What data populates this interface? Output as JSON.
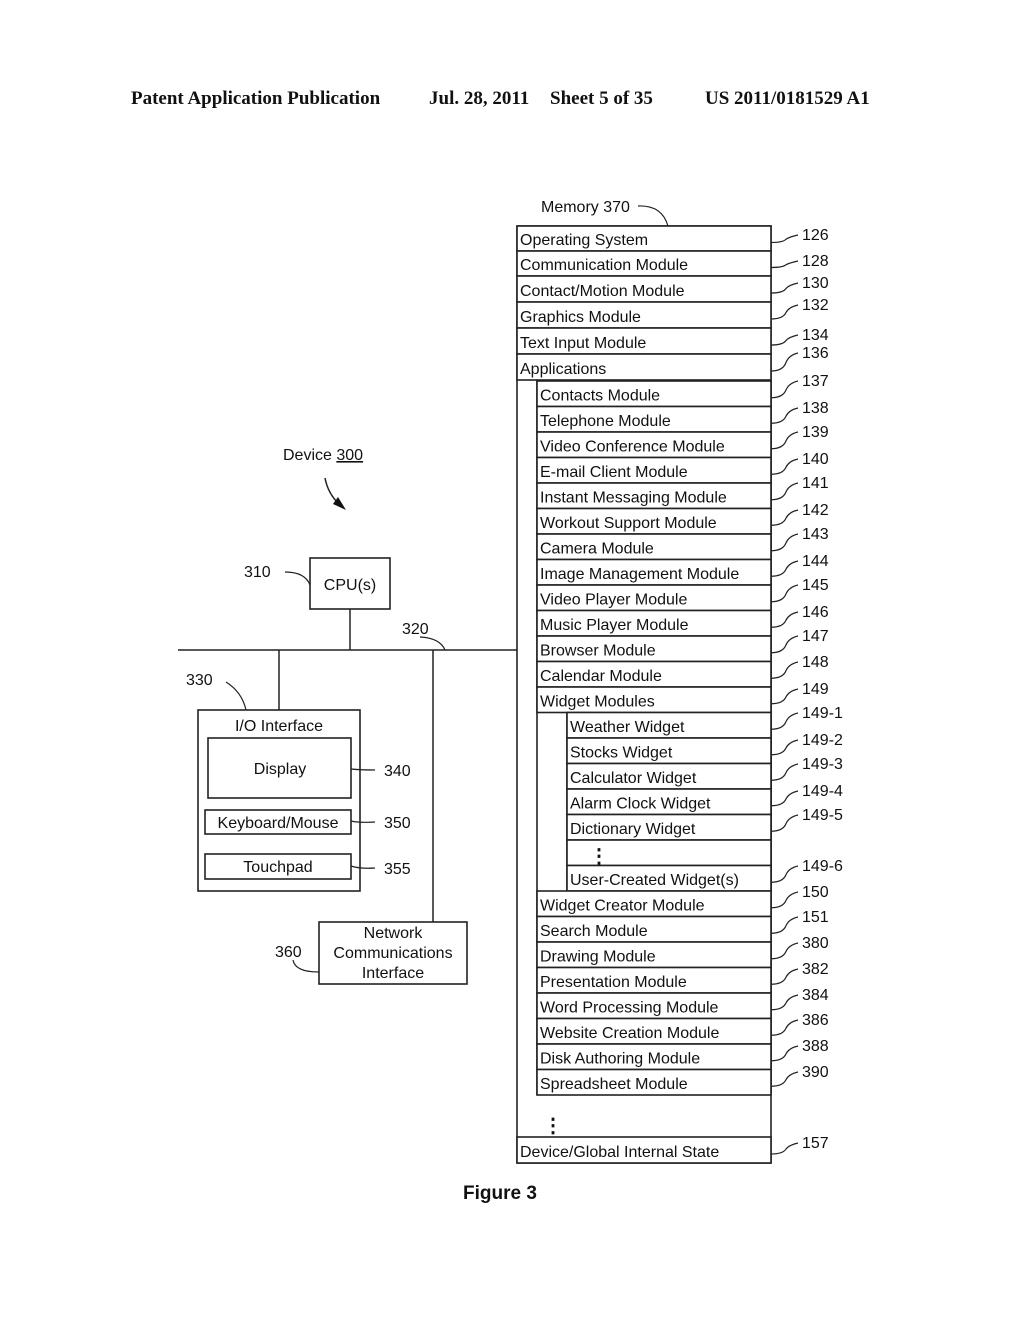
{
  "header": {
    "publication": "Patent Application Publication",
    "date": "Jul. 28, 2011",
    "sheet": "Sheet 5 of 35",
    "number": "US 2011/0181529 A1"
  },
  "device": {
    "label": "Device",
    "ref": "300",
    "cpu": {
      "label": "CPU(s)",
      "ref": "310"
    },
    "bus": {
      "ref": "320"
    },
    "io": {
      "label": "I/O Interface",
      "ref": "330",
      "display": {
        "label": "Display",
        "ref": "340"
      },
      "keyboard": {
        "label": "Keyboard/Mouse",
        "ref": "350"
      },
      "touchpad": {
        "label": "Touchpad",
        "ref": "355"
      }
    },
    "network": {
      "lines": [
        "Network",
        "Communications",
        "Interface"
      ],
      "ref": "360"
    }
  },
  "memory": {
    "label": "Memory 370",
    "top_rows": [
      {
        "label": "Operating System",
        "ref": "126"
      },
      {
        "label": "Communication Module",
        "ref": "128"
      },
      {
        "label": "Contact/Motion Module",
        "ref": "130"
      },
      {
        "label": "Graphics Module",
        "ref": "132"
      },
      {
        "label": "Text Input Module",
        "ref": "134"
      },
      {
        "label": "Applications",
        "ref": "136"
      }
    ],
    "apps": [
      {
        "label": "Contacts Module",
        "ref": "137"
      },
      {
        "label": "Telephone Module",
        "ref": "138"
      },
      {
        "label": "Video Conference Module",
        "ref": "139"
      },
      {
        "label": "E-mail Client Module",
        "ref": "140"
      },
      {
        "label": "Instant Messaging Module",
        "ref": "141"
      },
      {
        "label": "Workout Support Module",
        "ref": "142"
      },
      {
        "label": "Camera Module",
        "ref": "143"
      },
      {
        "label": "Image Management Module",
        "ref": "144"
      },
      {
        "label": "Video Player Module",
        "ref": "145"
      },
      {
        "label": "Music Player Module",
        "ref": "146"
      },
      {
        "label": "Browser Module",
        "ref": "147"
      },
      {
        "label": "Calendar Module",
        "ref": "148"
      },
      {
        "label": "Widget Modules",
        "ref": "149"
      }
    ],
    "widgets": [
      {
        "label": "Weather Widget",
        "ref": "149-1"
      },
      {
        "label": "Stocks Widget",
        "ref": "149-2"
      },
      {
        "label": "Calculator Widget",
        "ref": "149-3"
      },
      {
        "label": "Alarm Clock Widget",
        "ref": "149-4"
      },
      {
        "label": "Dictionary Widget",
        "ref": "149-5"
      },
      {
        "label": "⋮",
        "ref": ""
      },
      {
        "label": "User-Created Widget(s)",
        "ref": "149-6"
      }
    ],
    "apps_after": [
      {
        "label": "Widget Creator Module",
        "ref": "150"
      },
      {
        "label": "Search Module",
        "ref": "151"
      },
      {
        "label": "Drawing Module",
        "ref": "380"
      },
      {
        "label": "Presentation Module",
        "ref": "382"
      },
      {
        "label": "Word Processing  Module",
        "ref": "384"
      },
      {
        "label": "Website Creation Module",
        "ref": "386"
      },
      {
        "label": "Disk Authoring Module",
        "ref": "388"
      },
      {
        "label": "Spreadsheet Module",
        "ref": "390"
      }
    ],
    "ellipsis": "⋮",
    "bottom_row": {
      "label": "Device/Global Internal State",
      "ref": "157"
    }
  },
  "figure_caption": "Figure 3"
}
